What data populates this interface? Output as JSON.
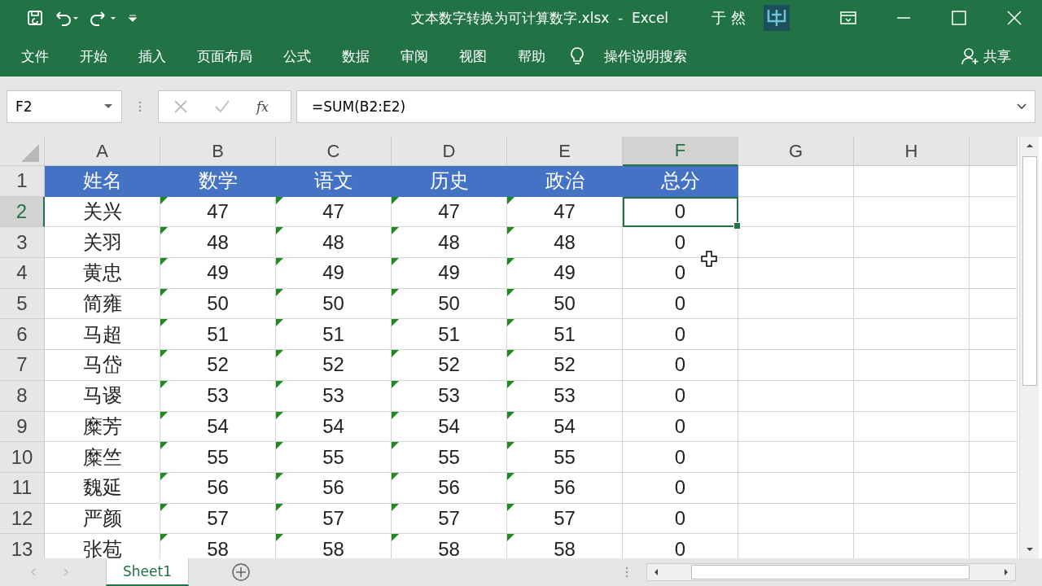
{
  "title_bar": {
    "title": "文本数字转换为可计算数字.xlsx  -  Excel",
    "user": "于 然"
  },
  "ribbon_tabs": [
    {
      "label": "文件"
    },
    {
      "label": "开始"
    },
    {
      "label": "插入"
    },
    {
      "label": "页面布局"
    },
    {
      "label": "公式"
    },
    {
      "label": "数据"
    },
    {
      "label": "审阅"
    },
    {
      "label": "视图"
    },
    {
      "label": "帮助"
    }
  ],
  "tell_me": "操作说明搜索",
  "share": "共享",
  "name_box": "F2",
  "fx_label": "fx",
  "formula": "=SUM(B2:E2)",
  "columns": [
    {
      "label": "A",
      "selected": false
    },
    {
      "label": "B",
      "selected": false
    },
    {
      "label": "C",
      "selected": false
    },
    {
      "label": "D",
      "selected": false
    },
    {
      "label": "E",
      "selected": false
    },
    {
      "label": "F",
      "selected": true
    },
    {
      "label": "G",
      "selected": false
    },
    {
      "label": "H",
      "selected": false
    }
  ],
  "rows": [
    {
      "number": "1",
      "selected": false,
      "kind": "header",
      "cells": [
        "姓名",
        "数学",
        "语文",
        "历史",
        "政治",
        "总分"
      ]
    },
    {
      "number": "2",
      "selected": true,
      "kind": "data",
      "cells": [
        "关兴",
        "47",
        "47",
        "47",
        "47",
        "0"
      ]
    },
    {
      "number": "3",
      "selected": false,
      "kind": "data",
      "cells": [
        "关羽",
        "48",
        "48",
        "48",
        "48",
        "0"
      ]
    },
    {
      "number": "4",
      "selected": false,
      "kind": "data",
      "cells": [
        "黄忠",
        "49",
        "49",
        "49",
        "49",
        "0"
      ]
    },
    {
      "number": "5",
      "selected": false,
      "kind": "data",
      "cells": [
        "简雍",
        "50",
        "50",
        "50",
        "50",
        "0"
      ]
    },
    {
      "number": "6",
      "selected": false,
      "kind": "data",
      "cells": [
        "马超",
        "51",
        "51",
        "51",
        "51",
        "0"
      ]
    },
    {
      "number": "7",
      "selected": false,
      "kind": "data",
      "cells": [
        "马岱",
        "52",
        "52",
        "52",
        "52",
        "0"
      ]
    },
    {
      "number": "8",
      "selected": false,
      "kind": "data",
      "cells": [
        "马谡",
        "53",
        "53",
        "53",
        "53",
        "0"
      ]
    },
    {
      "number": "9",
      "selected": false,
      "kind": "data",
      "cells": [
        "糜芳",
        "54",
        "54",
        "54",
        "54",
        "0"
      ]
    },
    {
      "number": "10",
      "selected": false,
      "kind": "data",
      "cells": [
        "糜竺",
        "55",
        "55",
        "55",
        "55",
        "0"
      ]
    },
    {
      "number": "11",
      "selected": false,
      "kind": "data",
      "cells": [
        "魏延",
        "56",
        "56",
        "56",
        "56",
        "0"
      ]
    },
    {
      "number": "12",
      "selected": false,
      "kind": "data",
      "cells": [
        "严颜",
        "57",
        "57",
        "57",
        "57",
        "0"
      ]
    },
    {
      "number": "13",
      "selected": false,
      "kind": "data",
      "cells": [
        "张苞",
        "58",
        "58",
        "58",
        "58",
        "0"
      ]
    }
  ],
  "text_number_flags": [
    false,
    true,
    true,
    true,
    true,
    false
  ],
  "sheet_tabs": [
    {
      "label": "Sheet1",
      "selected": true
    }
  ]
}
